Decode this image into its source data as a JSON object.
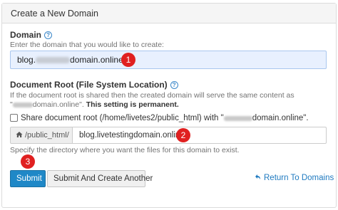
{
  "panel": {
    "title": "Create a New Domain"
  },
  "domain": {
    "label": "Domain",
    "help_icon": "question-circle-icon",
    "hint": "Enter the domain that you would like to create:",
    "value_prefix": "blog.",
    "value_suffix": "domain.online"
  },
  "docroot": {
    "label": "Document Root (File System Location)",
    "help_icon": "question-circle-icon",
    "note_line1": "If the document root is shared then the created domain will serve the same content as",
    "note_quote_open": "\"",
    "note_domain": "domain.online\".",
    "note_bold": "This setting is permanent.",
    "share_label_start": "Share document root (/home/livetes2/public_html) with \"",
    "share_label_end": "domain.online\".",
    "addon_icon": "home-icon",
    "addon_label": "/public_html/",
    "root_value": "blog.livetestingdomain.online",
    "hint": "Specify the directory where you want the files for this domain to exist."
  },
  "buttons": {
    "submit": "Submit",
    "submit_another": "Submit And Create Another",
    "return_icon": "return-arrow-icon",
    "return_link": "Return To Domains"
  },
  "badges": [
    "1",
    "2",
    "3"
  ],
  "colors": {
    "primary": "#1f88c7",
    "badge": "#e02020",
    "link": "#1f7ac0",
    "input_highlight": "#e8f0fe"
  }
}
